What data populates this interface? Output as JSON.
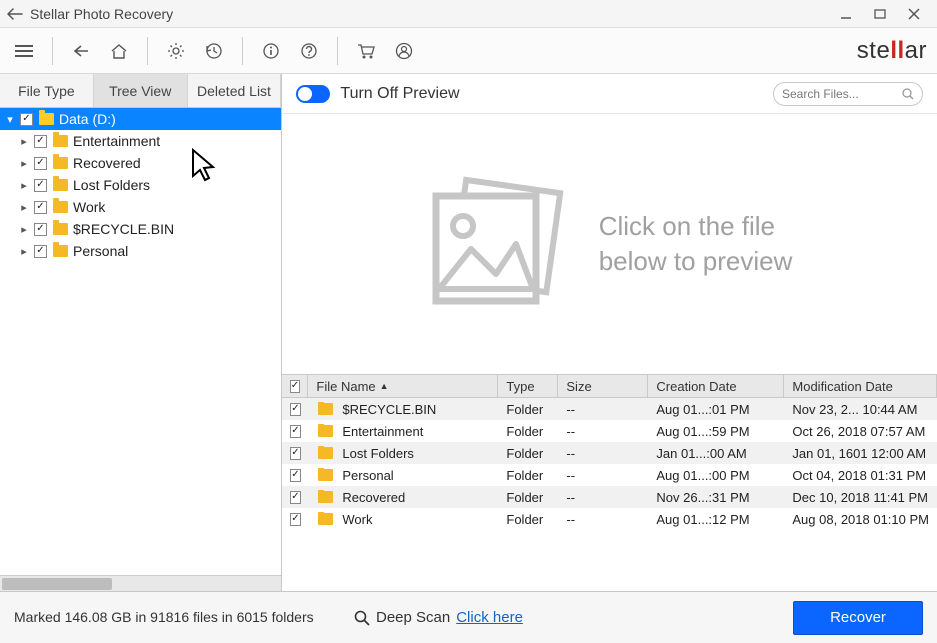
{
  "window": {
    "title": "Stellar Photo Recovery"
  },
  "brand": {
    "text_left": "ste",
    "text_mid": "ll",
    "text_right": "ar"
  },
  "tabs": {
    "file_type": "File Type",
    "tree_view": "Tree View",
    "deleted_list": "Deleted List"
  },
  "tree": {
    "root": {
      "label": "Data (D:)",
      "checked": true,
      "expanded": true
    },
    "children": [
      {
        "label": "Entertainment"
      },
      {
        "label": "Recovered"
      },
      {
        "label": "Lost Folders"
      },
      {
        "label": "Work"
      },
      {
        "label": "$RECYCLE.BIN"
      },
      {
        "label": "Personal"
      }
    ]
  },
  "preview": {
    "toggle_label": "Turn Off Preview",
    "search_placeholder": "Search Files...",
    "hint": "Click on the file below to preview"
  },
  "grid": {
    "headers": {
      "name": "File Name",
      "type": "Type",
      "size": "Size",
      "cdate": "Creation Date",
      "mdate": "Modification Date"
    },
    "rows": [
      {
        "name": "$RECYCLE.BIN",
        "type": "Folder",
        "size": "--",
        "cdate": "Aug 01...:01 PM",
        "mdate": "Nov 23, 2... 10:44 AM"
      },
      {
        "name": "Entertainment",
        "type": "Folder",
        "size": "--",
        "cdate": "Aug 01...:59 PM",
        "mdate": "Oct 26, 2018 07:57 AM"
      },
      {
        "name": "Lost Folders",
        "type": "Folder",
        "size": "--",
        "cdate": "Jan 01...:00 AM",
        "mdate": "Jan 01, 1601 12:00 AM"
      },
      {
        "name": "Personal",
        "type": "Folder",
        "size": "--",
        "cdate": "Aug 01...:00 PM",
        "mdate": "Oct 04, 2018 01:31 PM"
      },
      {
        "name": "Recovered",
        "type": "Folder",
        "size": "--",
        "cdate": "Nov 26...:31 PM",
        "mdate": "Dec 10, 2018 11:41 PM"
      },
      {
        "name": "Work",
        "type": "Folder",
        "size": "--",
        "cdate": "Aug 01...:12 PM",
        "mdate": "Aug 08, 2018 01:10 PM"
      }
    ]
  },
  "status": {
    "text": "Marked 146.08 GB in 91816 files in 6015 folders",
    "deep_label": "Deep Scan",
    "deep_link": "Click here",
    "recover": "Recover"
  }
}
